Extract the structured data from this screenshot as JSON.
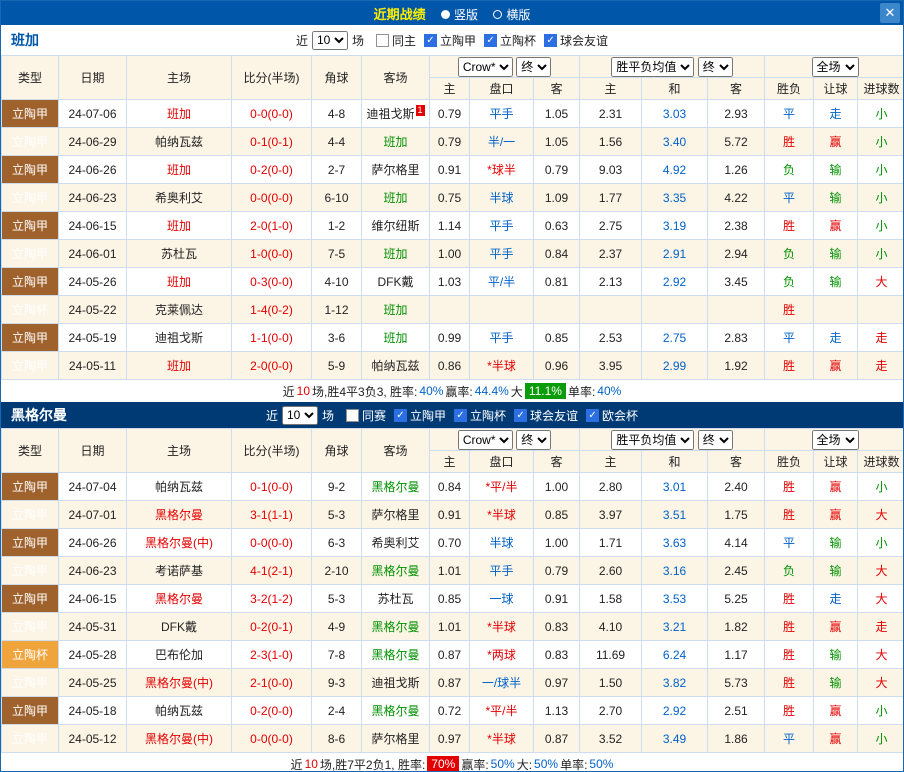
{
  "titlebar": {
    "title": "近期战绩",
    "layout_vertical": "竖版",
    "layout_horizontal": "横版",
    "close_icon": "✕"
  },
  "columns": {
    "type": "类型",
    "date": "日期",
    "home": "主场",
    "score": "比分(半场)",
    "corner": "角球",
    "away": "客场",
    "asia_home": "主",
    "asia_handicap": "盘口",
    "asia_away": "客",
    "euro_home": "主",
    "euro_draw": "和",
    "euro_away": "客",
    "result": "胜负",
    "let_result": "让球",
    "goal_result": "进球数",
    "odds_source": "Crow*",
    "final": "终",
    "euro_source": "胜平负均值",
    "scope": "全场"
  },
  "colors": {
    "accent_blue": "#0056a8",
    "section_bar": "#003a75",
    "title_yellow": "#ffef00",
    "win_red": "#e30000",
    "lose_green": "#009100",
    "draw_blue": "#0061c8",
    "league_jia": "#a0622d",
    "league_cup": "#f0a53c",
    "row_stripe": "#fcf5e6",
    "badge_green": "#0a9c0a",
    "badge_red": "#e30000"
  },
  "sections": [
    {
      "team": "班加",
      "filter": {
        "near": "近",
        "count": "10",
        "games": "场",
        "checks": [
          {
            "label": "同主",
            "checked": false
          },
          {
            "label": "立陶甲",
            "checked": true
          },
          {
            "label": "立陶杯",
            "checked": true
          },
          {
            "label": "球会友谊",
            "checked": true
          }
        ]
      },
      "rows": [
        {
          "league": "立陶甲",
          "league_style": "jia",
          "date": "24-07-06",
          "home": "班加",
          "home_color": "red",
          "score": "0-0(0-0)",
          "corner": "4-8",
          "away": "迪祖戈斯",
          "away_color": "black",
          "away_badge": "1",
          "asia_home": "0.79",
          "handicap": "平手",
          "handicap_color": "blue",
          "asia_away": "1.05",
          "euro_home": "2.31",
          "euro_draw": "3.03",
          "euro_away": "2.93",
          "result": "平",
          "result_color": "blue",
          "let": "走",
          "let_color": "blue",
          "goal": "小",
          "goal_color": "green"
        },
        {
          "league": "立陶甲",
          "league_style": "jia",
          "date": "24-06-29",
          "home": "帕纳瓦兹",
          "home_color": "black",
          "score": "0-1(0-1)",
          "corner": "4-4",
          "away": "班加",
          "away_color": "green",
          "asia_home": "0.79",
          "handicap": "半/一",
          "handicap_color": "blue",
          "asia_away": "1.05",
          "euro_home": "1.56",
          "euro_draw": "3.40",
          "euro_away": "5.72",
          "result": "胜",
          "result_color": "red",
          "let": "赢",
          "let_color": "red",
          "goal": "小",
          "goal_color": "green"
        },
        {
          "league": "立陶甲",
          "league_style": "jia",
          "date": "24-06-26",
          "home": "班加",
          "home_color": "red",
          "score": "0-2(0-0)",
          "corner": "2-7",
          "away": "萨尔格里",
          "away_color": "black",
          "asia_home": "0.91",
          "handicap": "*球半",
          "handicap_color": "red",
          "asia_away": "0.79",
          "euro_home": "9.03",
          "euro_draw": "4.92",
          "euro_away": "1.26",
          "result": "负",
          "result_color": "green",
          "let": "输",
          "let_color": "green",
          "goal": "小",
          "goal_color": "green"
        },
        {
          "league": "立陶甲",
          "league_style": "jia",
          "date": "24-06-23",
          "home": "希奥利艾",
          "home_color": "black",
          "score": "0-0(0-0)",
          "corner": "6-10",
          "away": "班加",
          "away_color": "green",
          "asia_home": "0.75",
          "handicap": "半球",
          "handicap_color": "blue",
          "asia_away": "1.09",
          "euro_home": "1.77",
          "euro_draw": "3.35",
          "euro_away": "4.22",
          "result": "平",
          "result_color": "blue",
          "let": "输",
          "let_color": "green",
          "goal": "小",
          "goal_color": "green"
        },
        {
          "league": "立陶甲",
          "league_style": "jia",
          "date": "24-06-15",
          "home": "班加",
          "home_color": "red",
          "score": "2-0(1-0)",
          "corner": "1-2",
          "away": "维尔纽斯",
          "away_color": "black",
          "asia_home": "1.14",
          "handicap": "平手",
          "handicap_color": "blue",
          "asia_away": "0.63",
          "euro_home": "2.75",
          "euro_draw": "3.19",
          "euro_away": "2.38",
          "result": "胜",
          "result_color": "red",
          "let": "赢",
          "let_color": "red",
          "goal": "小",
          "goal_color": "green"
        },
        {
          "league": "立陶甲",
          "league_style": "jia",
          "date": "24-06-01",
          "home": "苏杜瓦",
          "home_color": "black",
          "score": "1-0(0-0)",
          "corner": "7-5",
          "away": "班加",
          "away_color": "green",
          "asia_home": "1.00",
          "handicap": "平手",
          "handicap_color": "blue",
          "asia_away": "0.84",
          "euro_home": "2.37",
          "euro_draw": "2.91",
          "euro_away": "2.94",
          "result": "负",
          "result_color": "green",
          "let": "输",
          "let_color": "green",
          "goal": "小",
          "goal_color": "green"
        },
        {
          "league": "立陶甲",
          "league_style": "jia",
          "date": "24-05-26",
          "home": "班加",
          "home_color": "red",
          "score": "0-3(0-0)",
          "corner": "4-10",
          "away": "DFK戴",
          "away_color": "black",
          "asia_home": "1.03",
          "handicap": "平/半",
          "handicap_color": "blue",
          "asia_away": "0.81",
          "euro_home": "2.13",
          "euro_draw": "2.92",
          "euro_away": "3.45",
          "result": "负",
          "result_color": "green",
          "let": "输",
          "let_color": "green",
          "goal": "大",
          "goal_color": "red"
        },
        {
          "league": "立陶杯",
          "league_style": "cup",
          "date": "24-05-22",
          "home": "克莱佩达",
          "home_color": "black",
          "score": "1-4(0-2)",
          "corner": "1-12",
          "away": "班加",
          "away_color": "green",
          "asia_home": "",
          "handicap": "",
          "handicap_color": "blue",
          "asia_away": "",
          "euro_home": "",
          "euro_draw": "",
          "euro_away": "",
          "result": "胜",
          "result_color": "red",
          "let": "",
          "let_color": "black",
          "goal": "",
          "goal_color": "black"
        },
        {
          "league": "立陶甲",
          "league_style": "jia",
          "date": "24-05-19",
          "home": "迪祖戈斯",
          "home_color": "black",
          "score": "1-1(0-0)",
          "corner": "3-6",
          "away": "班加",
          "away_color": "green",
          "asia_home": "0.99",
          "handicap": "平手",
          "handicap_color": "blue",
          "asia_away": "0.85",
          "euro_home": "2.53",
          "euro_draw": "2.75",
          "euro_away": "2.83",
          "result": "平",
          "result_color": "blue",
          "let": "走",
          "let_color": "blue",
          "goal": "走",
          "goal_color": "red"
        },
        {
          "league": "立陶甲",
          "league_style": "jia",
          "date": "24-05-11",
          "home": "班加",
          "home_color": "red",
          "score": "2-0(0-0)",
          "corner": "5-9",
          "away": "帕纳瓦兹",
          "away_color": "black",
          "asia_home": "0.86",
          "handicap": "*半球",
          "handicap_color": "red",
          "asia_away": "0.96",
          "euro_home": "3.95",
          "euro_draw": "2.99",
          "euro_away": "1.92",
          "result": "胜",
          "result_color": "red",
          "let": "赢",
          "let_color": "red",
          "goal": "走",
          "goal_color": "red"
        }
      ],
      "summary": [
        {
          "t": "近",
          "s": ""
        },
        {
          "t": "10",
          "s": "red"
        },
        {
          "t": "场,胜4平3负3, 胜率:",
          "s": ""
        },
        {
          "t": "40%",
          "s": "blue"
        },
        {
          "t": " 赢率:",
          "s": ""
        },
        {
          "t": "44.4%",
          "s": "blue"
        },
        {
          "t": " 大 ",
          "s": ""
        },
        {
          "t": "11.1%",
          "s": "badge-green"
        },
        {
          "t": " 单率:",
          "s": ""
        },
        {
          "t": "40%",
          "s": "blue"
        }
      ]
    },
    {
      "team": "黑格尔曼",
      "filter": {
        "near": "近",
        "count": "10",
        "games": "场",
        "checks": [
          {
            "label": "同赛",
            "checked": false
          },
          {
            "label": "立陶甲",
            "checked": true
          },
          {
            "label": "立陶杯",
            "checked": true
          },
          {
            "label": "球会友谊",
            "checked": true
          },
          {
            "label": "欧会杯",
            "checked": true
          }
        ]
      },
      "rows": [
        {
          "league": "立陶甲",
          "league_style": "jia",
          "date": "24-07-04",
          "home": "帕纳瓦兹",
          "home_color": "black",
          "score": "0-1(0-0)",
          "corner": "9-2",
          "away": "黑格尔曼",
          "away_color": "green",
          "asia_home": "0.84",
          "handicap": "*平/半",
          "handicap_color": "red",
          "asia_away": "1.00",
          "euro_home": "2.80",
          "euro_draw": "3.01",
          "euro_away": "2.40",
          "result": "胜",
          "result_color": "red",
          "let": "赢",
          "let_color": "red",
          "goal": "小",
          "goal_color": "green"
        },
        {
          "league": "立陶甲",
          "league_style": "jia",
          "date": "24-07-01",
          "home": "黑格尔曼",
          "home_color": "red",
          "score": "3-1(1-1)",
          "corner": "5-3",
          "away": "萨尔格里",
          "away_color": "black",
          "asia_home": "0.91",
          "handicap": "*半球",
          "handicap_color": "red",
          "asia_away": "0.85",
          "euro_home": "3.97",
          "euro_draw": "3.51",
          "euro_away": "1.75",
          "result": "胜",
          "result_color": "red",
          "let": "赢",
          "let_color": "red",
          "goal": "大",
          "goal_color": "red"
        },
        {
          "league": "立陶甲",
          "league_style": "jia",
          "date": "24-06-26",
          "home": "黑格尔曼(中)",
          "home_color": "red",
          "score": "0-0(0-0)",
          "corner": "6-3",
          "away": "希奥利艾",
          "away_color": "black",
          "asia_home": "0.70",
          "handicap": "半球",
          "handicap_color": "blue",
          "asia_away": "1.00",
          "euro_home": "1.71",
          "euro_draw": "3.63",
          "euro_away": "4.14",
          "result": "平",
          "result_color": "blue",
          "let": "输",
          "let_color": "green",
          "goal": "小",
          "goal_color": "green"
        },
        {
          "league": "立陶甲",
          "league_style": "jia",
          "date": "24-06-23",
          "home": "考诺萨基",
          "home_color": "black",
          "score": "4-1(2-1)",
          "corner": "2-10",
          "away": "黑格尔曼",
          "away_color": "green",
          "asia_home": "1.01",
          "handicap": "平手",
          "handicap_color": "blue",
          "asia_away": "0.79",
          "euro_home": "2.60",
          "euro_draw": "3.16",
          "euro_away": "2.45",
          "result": "负",
          "result_color": "green",
          "let": "输",
          "let_color": "green",
          "goal": "大",
          "goal_color": "red"
        },
        {
          "league": "立陶甲",
          "league_style": "jia",
          "date": "24-06-15",
          "home": "黑格尔曼",
          "home_color": "red",
          "score": "3-2(1-2)",
          "corner": "5-3",
          "away": "苏杜瓦",
          "away_color": "black",
          "asia_home": "0.85",
          "handicap": "一球",
          "handicap_color": "blue",
          "asia_away": "0.91",
          "euro_home": "1.58",
          "euro_draw": "3.53",
          "euro_away": "5.25",
          "result": "胜",
          "result_color": "red",
          "let": "走",
          "let_color": "blue",
          "goal": "大",
          "goal_color": "red"
        },
        {
          "league": "立陶甲",
          "league_style": "jia",
          "date": "24-05-31",
          "home": "DFK戴",
          "home_color": "black",
          "score": "0-2(0-1)",
          "corner": "4-9",
          "away": "黑格尔曼",
          "away_color": "green",
          "asia_home": "1.01",
          "handicap": "*半球",
          "handicap_color": "red",
          "asia_away": "0.83",
          "euro_home": "4.10",
          "euro_draw": "3.21",
          "euro_away": "1.82",
          "result": "胜",
          "result_color": "red",
          "let": "赢",
          "let_color": "red",
          "goal": "走",
          "goal_color": "red"
        },
        {
          "league": "立陶杯",
          "league_style": "cup",
          "date": "24-05-28",
          "home": "巴布伦加",
          "home_color": "black",
          "score": "2-3(1-0)",
          "corner": "7-8",
          "away": "黑格尔曼",
          "away_color": "green",
          "asia_home": "0.87",
          "handicap": "*两球",
          "handicap_color": "red",
          "asia_away": "0.83",
          "euro_home": "11.69",
          "euro_draw": "6.24",
          "euro_away": "1.17",
          "result": "胜",
          "result_color": "red",
          "let": "输",
          "let_color": "green",
          "goal": "大",
          "goal_color": "red"
        },
        {
          "league": "立陶甲",
          "league_style": "jia",
          "date": "24-05-25",
          "home": "黑格尔曼(中)",
          "home_color": "red",
          "score": "2-1(0-0)",
          "corner": "9-3",
          "away": "迪祖戈斯",
          "away_color": "black",
          "asia_home": "0.87",
          "handicap": "一/球半",
          "handicap_color": "blue",
          "asia_away": "0.97",
          "euro_home": "1.50",
          "euro_draw": "3.82",
          "euro_away": "5.73",
          "result": "胜",
          "result_color": "red",
          "let": "输",
          "let_color": "green",
          "goal": "大",
          "goal_color": "red"
        },
        {
          "league": "立陶甲",
          "league_style": "jia",
          "date": "24-05-18",
          "home": "帕纳瓦兹",
          "home_color": "black",
          "score": "0-2(0-0)",
          "corner": "2-4",
          "away": "黑格尔曼",
          "away_color": "green",
          "asia_home": "0.72",
          "handicap": "*平/半",
          "handicap_color": "red",
          "asia_away": "1.13",
          "euro_home": "2.70",
          "euro_draw": "2.92",
          "euro_away": "2.51",
          "result": "胜",
          "result_color": "red",
          "let": "赢",
          "let_color": "red",
          "goal": "小",
          "goal_color": "green"
        },
        {
          "league": "立陶甲",
          "league_style": "jia",
          "date": "24-05-12",
          "home": "黑格尔曼(中)",
          "home_color": "red",
          "score": "0-0(0-0)",
          "corner": "8-6",
          "away": "萨尔格里",
          "away_color": "black",
          "asia_home": "0.97",
          "handicap": "*半球",
          "handicap_color": "red",
          "asia_away": "0.87",
          "euro_home": "3.52",
          "euro_draw": "3.49",
          "euro_away": "1.86",
          "result": "平",
          "result_color": "blue",
          "let": "赢",
          "let_color": "red",
          "goal": "小",
          "goal_color": "green"
        }
      ],
      "summary": [
        {
          "t": "近",
          "s": ""
        },
        {
          "t": "10",
          "s": "red"
        },
        {
          "t": "场,胜7平2负1, 胜率:",
          "s": ""
        },
        {
          "t": "70%",
          "s": "badge-red"
        },
        {
          "t": " 赢率:",
          "s": ""
        },
        {
          "t": "50%",
          "s": "blue"
        },
        {
          "t": " 大:",
          "s": ""
        },
        {
          "t": "50%",
          "s": "blue"
        },
        {
          "t": " 单率:",
          "s": ""
        },
        {
          "t": "50%",
          "s": "blue"
        }
      ]
    }
  ]
}
